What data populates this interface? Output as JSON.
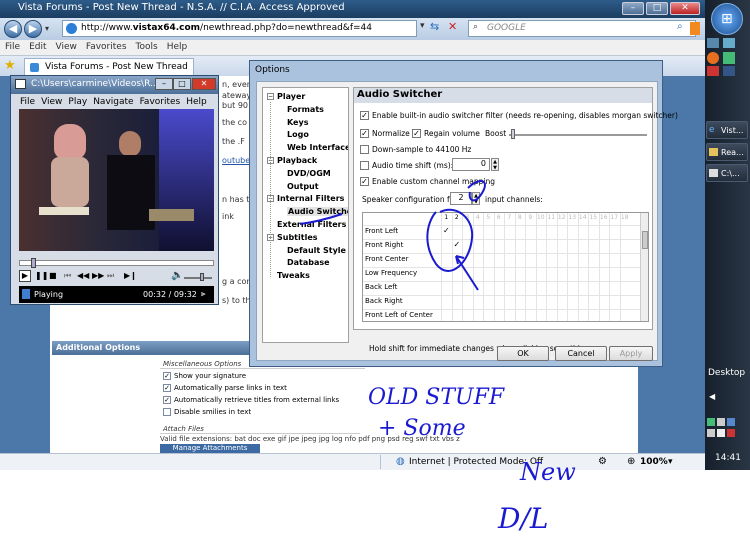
{
  "browser": {
    "title": "Vista Forums - Post New Thread - N.S.A. // C.I.A. Access Approved",
    "url_prefix": "http://www.",
    "url_host": "vistax64.com",
    "url_path": "/newthread.php?do=newthread&f=44",
    "search_placeholder": "GOOGLE",
    "menu": [
      "File",
      "Edit",
      "View",
      "Favorites",
      "Tools",
      "Help"
    ],
    "tab_label": "Vista Forums - Post New Thread",
    "status_zone": "Internet | Protected Mode: Off",
    "zoom": "100%"
  },
  "forum": {
    "snippets": [
      "n, even",
      "ateway",
      "but 90",
      "the co",
      "the .F",
      "outube",
      "n has t",
      "ink",
      "g a com",
      "s) to th"
    ],
    "additional_options": "Additional Options",
    "misc_options": "Miscellaneous Options",
    "options": [
      {
        "label": "Show your signature",
        "checked": true
      },
      {
        "label": "Automatically parse links in text",
        "checked": true
      },
      {
        "label": "Automatically retrieve titles from external links",
        "checked": true
      },
      {
        "label": "Disable smilies in text",
        "checked": false
      }
    ],
    "attach_files": "Attach Files",
    "valid_extensions": "Valid file extensions: bat doc exe gif jpe jpeg jpg log nfo pdf png psd reg swf txt vbs zip",
    "manage_attachments": "Manage Attachments"
  },
  "player": {
    "title": "C:\\Users\\carmine\\Videos\\R...",
    "menu": [
      "File",
      "View",
      "Play",
      "Navigate",
      "Favorites",
      "Help"
    ],
    "status": "Playing",
    "time": "00:32 / 09:32"
  },
  "options_dialog": {
    "title": "Options",
    "tree": [
      {
        "label": "Player",
        "level": 0,
        "expander": "−"
      },
      {
        "label": "Formats",
        "level": 1
      },
      {
        "label": "Keys",
        "level": 1
      },
      {
        "label": "Logo",
        "level": 1
      },
      {
        "label": "Web Interface",
        "level": 1
      },
      {
        "label": "Playback",
        "level": 0,
        "expander": "−"
      },
      {
        "label": "DVD/OGM",
        "level": 1
      },
      {
        "label": "Output",
        "level": 1
      },
      {
        "label": "Internal Filters",
        "level": 0,
        "expander": "−"
      },
      {
        "label": "Audio Switcher",
        "level": 1,
        "selected": true
      },
      {
        "label": "External Filters",
        "level": 0
      },
      {
        "label": "Subtitles",
        "level": 0,
        "expander": "−"
      },
      {
        "label": "Default Style",
        "level": 1
      },
      {
        "label": "Database",
        "level": 1
      },
      {
        "label": "Tweaks",
        "level": 0
      }
    ],
    "panel_title": "Audio Switcher",
    "enable_builtin": "Enable built-in audio switcher filter (needs re-opening, disables morgan switcher)",
    "normalize": "Normalize",
    "regain_volume": "Regain volume",
    "boost": "Boost",
    "downsample": "Down-sample to 44100 Hz",
    "time_shift": "Audio time shift (ms):",
    "time_shift_value": "0",
    "custom_mapping": "Enable custom channel mapping",
    "speaker_config_prefix": "Speaker configuration for",
    "input_channels": "2",
    "speaker_config_suffix": "input channels:",
    "grid_headers": [
      "1",
      "2",
      "3",
      "4",
      "5",
      "6",
      "7",
      "8",
      "9",
      "10",
      "11",
      "12",
      "13",
      "14",
      "15",
      "16",
      "17",
      "18"
    ],
    "grid_rows": [
      "Front Left",
      "Front Right",
      "Front Center",
      "Low Frequency",
      "Back Left",
      "Back Right",
      "Front Left of Center"
    ],
    "hint": "Hold shift for immediate changes when clicking something",
    "ok": "OK",
    "cancel": "Cancel",
    "apply": "Apply"
  },
  "taskbar": {
    "items": [
      "Vist...",
      "Rea...",
      "C:\\..."
    ],
    "desktop": "Desktop",
    "clock": "14:41"
  },
  "annotation": {
    "line1": "OLD STUFF",
    "line2": "+ Some",
    "line3": "New",
    "line4": "D/L"
  }
}
